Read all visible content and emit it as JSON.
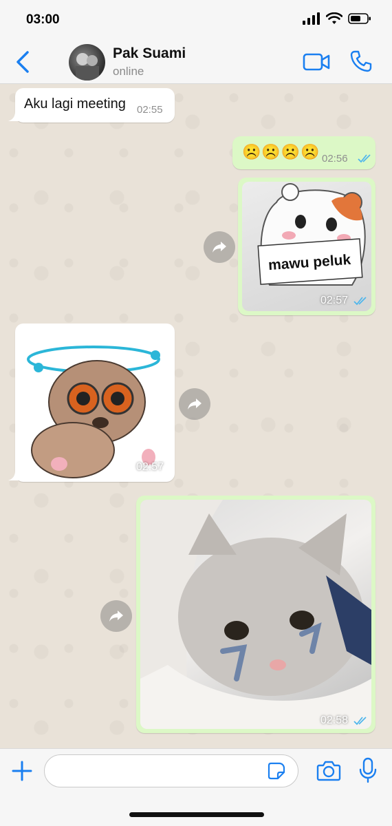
{
  "status_bar": {
    "time": "03:00"
  },
  "header": {
    "name": "Pak Suami",
    "status": "online"
  },
  "messages": {
    "m1": {
      "text": "Aku lagi meeting",
      "time": "02:55"
    },
    "m2": {
      "text": "☹️☹️☹️☹️",
      "time": "02:56"
    },
    "m3": {
      "caption": "mawu peluk",
      "time": "02:57"
    },
    "m4": {
      "time": "02:57"
    },
    "m5": {
      "time": "02:58"
    }
  },
  "colors": {
    "accent": "#1a7ff0",
    "outgoing_bubble": "#dcf8c6",
    "incoming_bubble": "#ffffff",
    "chat_bg": "#e9e2d8",
    "read_ticks": "#4fb6ec"
  },
  "icons": {
    "back": "chevron-left-icon",
    "video": "video-camera-icon",
    "call": "phone-icon",
    "forward": "forward-icon",
    "plus": "plus-icon",
    "sticker": "sticker-icon",
    "camera": "camera-icon",
    "mic": "microphone-icon"
  }
}
